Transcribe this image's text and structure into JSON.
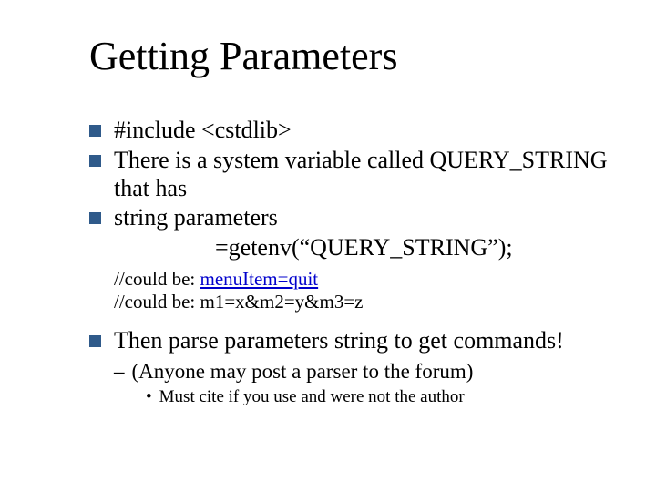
{
  "title": "Getting Parameters",
  "bullets": {
    "b1": "#include <cstdlib>",
    "b2": "There is a system variable called QUERY_STRING that has",
    "b3": "string parameters",
    "b3_code": "=getenv(“QUERY_STRING”);",
    "comment1_prefix": "//could be:  ",
    "comment1_link": "menuItem=quit",
    "comment2": "//could be:  m1=x&m2=y&m3=z",
    "b4": "Then parse parameters string to get commands!",
    "sub_dash": "(Anyone may post a parser to the forum)",
    "sub_dot": "Must cite if you use and were not the author"
  },
  "glyphs": {
    "dash": "–",
    "dot": "•"
  }
}
